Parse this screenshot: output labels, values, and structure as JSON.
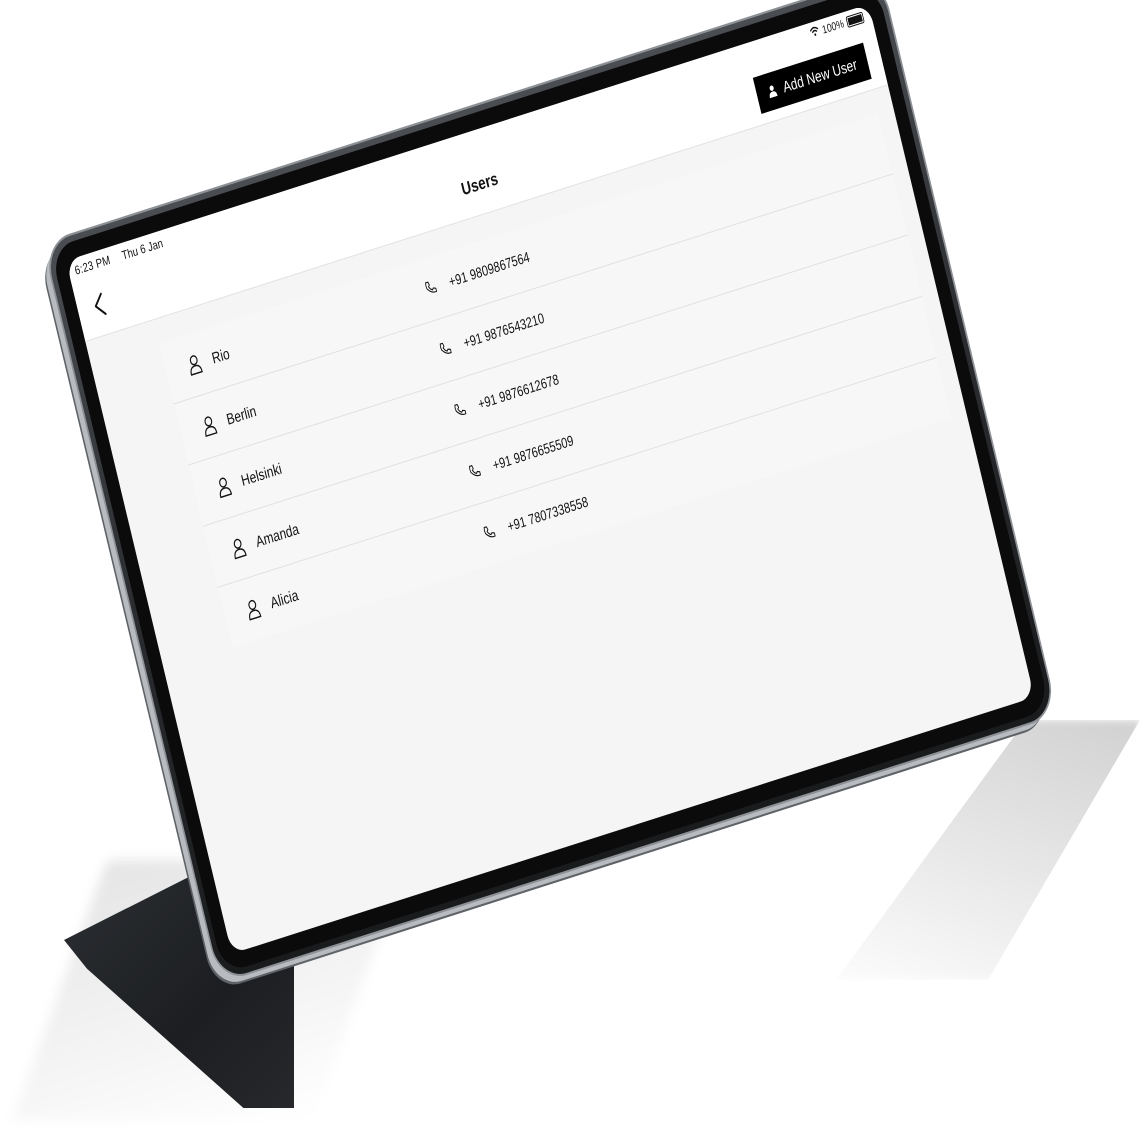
{
  "status_bar": {
    "time": "6:23 PM",
    "date": "Thu 6 Jan",
    "battery_text": "100%"
  },
  "nav": {
    "title": "Users",
    "add_button_label": "Add New User"
  },
  "users": [
    {
      "name": "Rio",
      "phone": "+91 9809867564"
    },
    {
      "name": "Berlin",
      "phone": "+91 9876543210"
    },
    {
      "name": "Helsinki",
      "phone": "+91 9876612678"
    },
    {
      "name": "Amanda",
      "phone": "+91 9876655509"
    },
    {
      "name": "Alicia",
      "phone": "+91 7807338558"
    }
  ],
  "icons": {
    "back": "chevron-left-icon",
    "add_user": "person-icon",
    "user": "person-outline-icon",
    "phone": "phone-icon",
    "wifi": "wifi-icon",
    "battery": "battery-icon"
  },
  "colors": {
    "button_bg": "#000000",
    "screen_bg": "#f5f5f5",
    "header_bg": "#ffffff",
    "device_frame": "#1a1b1d"
  }
}
